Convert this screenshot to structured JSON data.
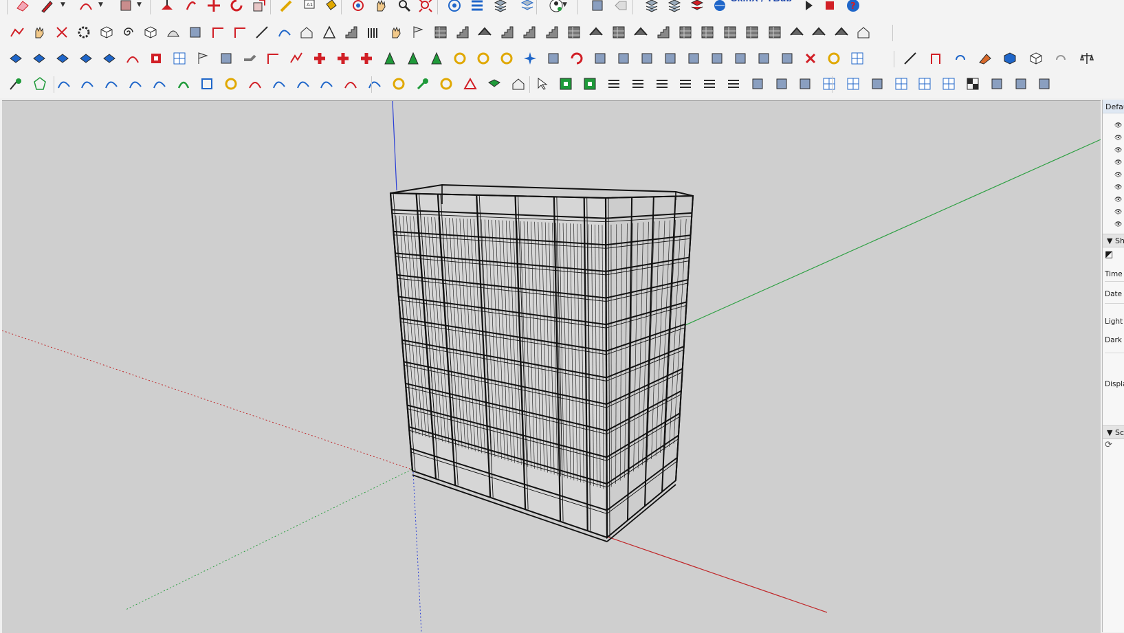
{
  "toolbar": {
    "row1": [
      {
        "name": "eraser-tool",
        "glyph": "eraser"
      },
      {
        "name": "pencil-line-tool",
        "glyph": "pencil"
      },
      {
        "name": "arc-tool",
        "glyph": "arc"
      },
      {
        "name": "rectangle-tool",
        "glyph": "rect"
      },
      {
        "name": "push-pull-tool",
        "glyph": "pushpull"
      },
      {
        "name": "follow-me-tool",
        "glyph": "followme"
      },
      {
        "name": "move-tool",
        "glyph": "move"
      },
      {
        "name": "rotate-tool",
        "glyph": "rotate"
      },
      {
        "name": "scale-tool",
        "glyph": "scale"
      },
      {
        "name": "tape-measure-tool",
        "glyph": "tape"
      },
      {
        "name": "text-tool",
        "glyph": "text"
      },
      {
        "name": "paint-bucket-tool",
        "glyph": "bucket"
      },
      {
        "name": "orbit-tool",
        "glyph": "orbit"
      },
      {
        "name": "pan-tool",
        "glyph": "hand"
      },
      {
        "name": "zoom-tool",
        "glyph": "zoom"
      },
      {
        "name": "zoom-extents-tool",
        "glyph": "zoomext"
      },
      {
        "name": "model-info-icon",
        "glyph": "info"
      },
      {
        "name": "outliner-icon",
        "glyph": "layers"
      },
      {
        "name": "stack-icon",
        "glyph": "stack"
      },
      {
        "name": "settings-stack-icon",
        "glyph": "gearstack"
      },
      {
        "name": "account-icon",
        "glyph": "user"
      },
      {
        "name": "extension-warehouse-icon",
        "glyph": "box"
      },
      {
        "name": "send-to-layout-icon",
        "glyph": "tag"
      },
      {
        "name": "layer-stack-icon",
        "glyph": "stack"
      },
      {
        "name": "layer-stack-2-icon",
        "glyph": "stack"
      },
      {
        "name": "red-stack-icon",
        "glyph": "redstack"
      },
      {
        "name": "globe-stack-icon",
        "glyph": "globe"
      }
    ],
    "plugin_label": "SkinX / YBub",
    "play_icon": "play-icon",
    "stop_icon": "stop-icon",
    "help_icon": "help-icon",
    "row_glyphs": {
      "r2": [
        "polyline",
        "hand",
        "scissors",
        "gear",
        "cube",
        "spiral",
        "cube",
        "dome",
        "arch",
        "corner",
        "corner",
        "line",
        "curve",
        "house",
        "tri",
        "stairs",
        "columns",
        "hand",
        "flag",
        "wall",
        "stairs",
        "roof",
        "stairs",
        "stairs",
        "stairs",
        "wall",
        "roof",
        "wall",
        "roof",
        "stairs",
        "wall",
        "wall",
        "wall",
        "wall",
        "wall",
        "roof",
        "roof",
        "roof",
        "house"
      ],
      "r3": [
        "tile",
        "tile",
        "tile",
        "tile",
        "tile",
        "arc",
        "redsq",
        "grid",
        "flag",
        "box",
        "pipe",
        "corner",
        "redline",
        "cross",
        "cross",
        "cross",
        "cone",
        "cone",
        "cone",
        "circle",
        "circle",
        "circle",
        "star",
        "box",
        "redarc",
        "box",
        "box",
        "box",
        "box",
        "box",
        "box",
        "box",
        "box",
        "box",
        "redx",
        "circle",
        "grid"
      ],
      "r4": [
        "pen",
        "polygon",
        "curve",
        "curve",
        "curve",
        "curve",
        "curve",
        "greenarc",
        "square",
        "circle",
        "arc",
        "curve",
        "curve",
        "curve",
        "arc",
        "curve",
        "circle",
        "wrench",
        "circle",
        "triangle",
        "book",
        "house",
        "cursor",
        "greenbox",
        "greenbox",
        "lines",
        "lines",
        "lines",
        "lines",
        "lines",
        "lines",
        "box",
        "box",
        "box",
        "grid",
        "grid",
        "box",
        "grid",
        "grid",
        "grid",
        "checker",
        "box",
        "box",
        "box"
      ]
    },
    "row2_right": [
      {
        "name": "line-icon",
        "glyph": "line"
      },
      {
        "name": "section-icon",
        "glyph": "section"
      },
      {
        "name": "redo-icon",
        "glyph": "redo"
      },
      {
        "name": "paint-icon",
        "glyph": "paint"
      },
      {
        "name": "component-icon",
        "glyph": "component"
      },
      {
        "name": "blue-cube-icon",
        "glyph": "cube"
      },
      {
        "name": "undo-icon",
        "glyph": "undo"
      },
      {
        "name": "scale-balance-icon",
        "glyph": "balance"
      }
    ]
  },
  "tray": {
    "header": "Defau",
    "eye_icon": "eye-icon",
    "shadows_header": "Sh",
    "shadows_labels": [
      "Time",
      "Date",
      "Light",
      "Dark",
      "Displa"
    ],
    "scenes_header": "Sc"
  },
  "colors": {
    "viewport_bg": "#cfcfcf",
    "axis_red": "#c0282a",
    "axis_green": "#2ea043",
    "axis_blue": "#2a3fd6",
    "building_line": "#111111"
  }
}
